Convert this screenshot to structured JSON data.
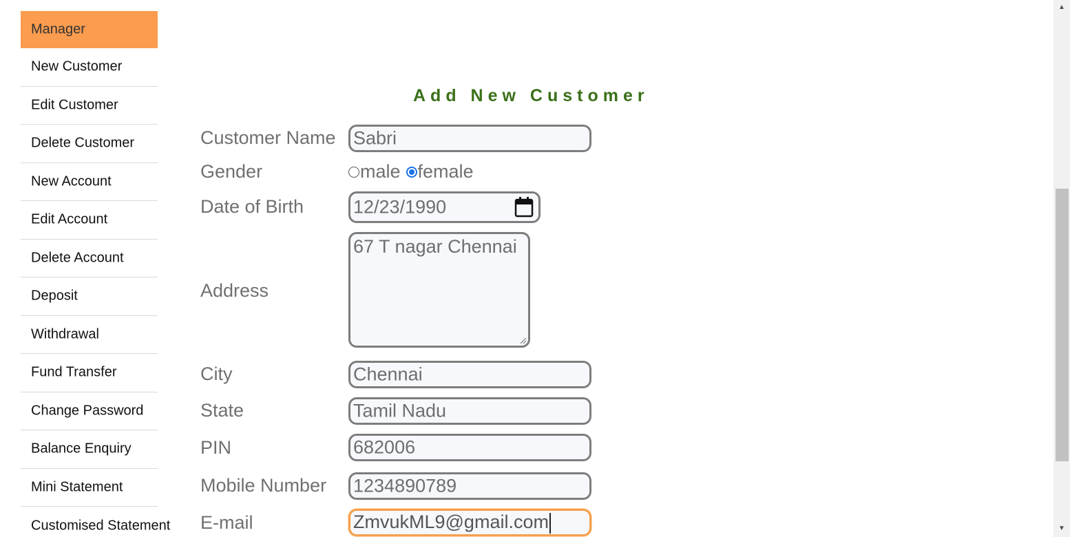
{
  "sidebar": {
    "items": [
      {
        "label": "Manager"
      },
      {
        "label": "New Customer"
      },
      {
        "label": "Edit Customer"
      },
      {
        "label": "Delete Customer"
      },
      {
        "label": "New Account"
      },
      {
        "label": "Edit Account"
      },
      {
        "label": "Delete Account"
      },
      {
        "label": "Deposit"
      },
      {
        "label": "Withdrawal"
      },
      {
        "label": "Fund Transfer"
      },
      {
        "label": "Change Password"
      },
      {
        "label": "Balance Enquiry"
      },
      {
        "label": "Mini Statement"
      },
      {
        "label": "Customised Statement"
      }
    ]
  },
  "form": {
    "title": "Add New Customer",
    "customer_name": {
      "label": "Customer Name",
      "value": "Sabri"
    },
    "gender": {
      "label": "Gender",
      "options": [
        {
          "label": "male",
          "checked": false
        },
        {
          "label": "female",
          "checked": true
        }
      ]
    },
    "dob": {
      "label": "Date of Birth",
      "value": "12/23/1990",
      "icon": "calendar-icon"
    },
    "address": {
      "label": "Address",
      "value": "67 T nagar Chennai"
    },
    "city": {
      "label": "City",
      "value": "Chennai"
    },
    "state": {
      "label": "State",
      "value": "Tamil Nadu"
    },
    "pin": {
      "label": "PIN",
      "value": "682006"
    },
    "mobile": {
      "label": "Mobile Number",
      "value": "1234890789"
    },
    "email": {
      "label": "E-mail",
      "value": "ZmvukML9@gmail.com",
      "focused": true
    }
  },
  "colors": {
    "menu_header_bg": "#fb9c4f",
    "title": "#3a7019",
    "focus_border": "#f5a04c",
    "radio_accent": "#1a73e8"
  }
}
